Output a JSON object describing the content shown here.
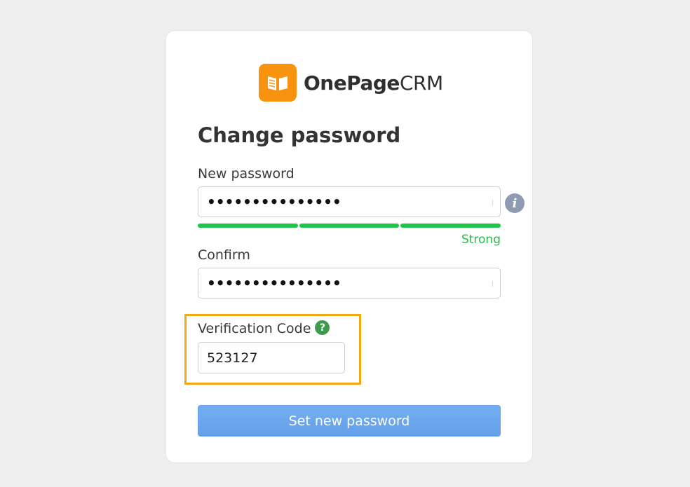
{
  "brand": {
    "name_bold": "OnePage",
    "name_light": "CRM",
    "badge_color": "#f7930f",
    "logo_icon": "open-book-icon"
  },
  "form": {
    "title": "Change password",
    "new_password": {
      "label": "New password",
      "masked_value": "•••••••••••••••",
      "strength_label": "Strong",
      "strength_color": "#1cc74a",
      "strength_segments_filled": 3,
      "strength_segments_total": 3
    },
    "info_icon": "info-icon",
    "confirm": {
      "label": "Confirm",
      "masked_value": "•••••••••••••••"
    },
    "verification": {
      "label": "Verification Code",
      "help_glyph": "?",
      "value": "523127",
      "highlight_color": "#f2a916"
    },
    "submit_label": "Set new password"
  }
}
